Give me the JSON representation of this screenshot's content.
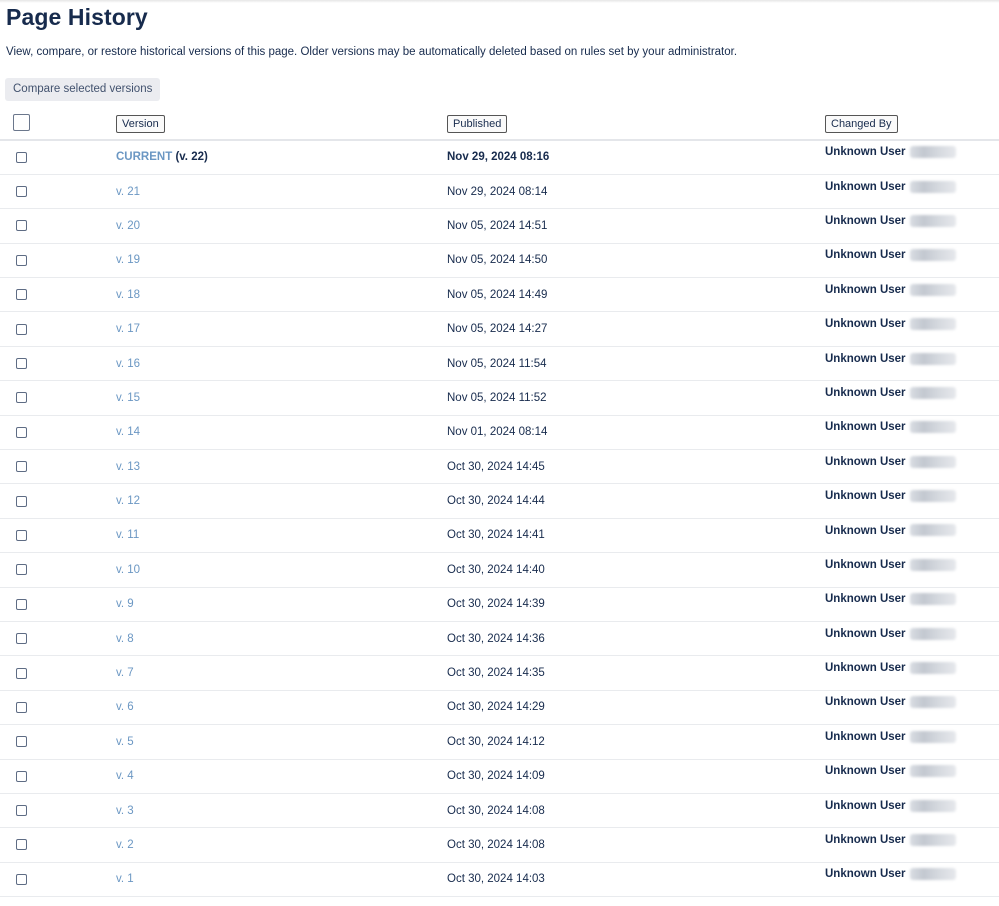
{
  "page": {
    "title": "Page History",
    "intro": "View, compare, or restore historical versions of this page. Older versions may be automatically deleted based on rules set by your administrator.",
    "compare_label": "Compare selected versions"
  },
  "table": {
    "headers": {
      "version": "Version",
      "published": "Published",
      "changed_by": "Changed By"
    },
    "current": {
      "label": "CURRENT",
      "suffix": "(v. 22)",
      "published": "Nov 29, 2024 08:16",
      "changed_by": "Unknown User"
    },
    "rows": [
      {
        "version": "v. 21",
        "published": "Nov 29, 2024 08:14",
        "changed_by": "Unknown User"
      },
      {
        "version": "v. 20",
        "published": "Nov 05, 2024 14:51",
        "changed_by": "Unknown User"
      },
      {
        "version": "v. 19",
        "published": "Nov 05, 2024 14:50",
        "changed_by": "Unknown User"
      },
      {
        "version": "v. 18",
        "published": "Nov 05, 2024 14:49",
        "changed_by": "Unknown User"
      },
      {
        "version": "v. 17",
        "published": "Nov 05, 2024 14:27",
        "changed_by": "Unknown User"
      },
      {
        "version": "v. 16",
        "published": "Nov 05, 2024 11:54",
        "changed_by": "Unknown User"
      },
      {
        "version": "v. 15",
        "published": "Nov 05, 2024 11:52",
        "changed_by": "Unknown User"
      },
      {
        "version": "v. 14",
        "published": "Nov 01, 2024 08:14",
        "changed_by": "Unknown User"
      },
      {
        "version": "v. 13",
        "published": "Oct 30, 2024 14:45",
        "changed_by": "Unknown User"
      },
      {
        "version": "v. 12",
        "published": "Oct 30, 2024 14:44",
        "changed_by": "Unknown User"
      },
      {
        "version": "v. 11",
        "published": "Oct 30, 2024 14:41",
        "changed_by": "Unknown User"
      },
      {
        "version": "v. 10",
        "published": "Oct 30, 2024 14:40",
        "changed_by": "Unknown User"
      },
      {
        "version": "v. 9",
        "published": "Oct 30, 2024 14:39",
        "changed_by": "Unknown User"
      },
      {
        "version": "v. 8",
        "published": "Oct 30, 2024 14:36",
        "changed_by": "Unknown User"
      },
      {
        "version": "v. 7",
        "published": "Oct 30, 2024 14:35",
        "changed_by": "Unknown User"
      },
      {
        "version": "v. 6",
        "published": "Oct 30, 2024 14:29",
        "changed_by": "Unknown User"
      },
      {
        "version": "v. 5",
        "published": "Oct 30, 2024 14:12",
        "changed_by": "Unknown User"
      },
      {
        "version": "v. 4",
        "published": "Oct 30, 2024 14:09",
        "changed_by": "Unknown User"
      },
      {
        "version": "v. 3",
        "published": "Oct 30, 2024 14:08",
        "changed_by": "Unknown User"
      },
      {
        "version": "v. 2",
        "published": "Oct 30, 2024 14:08",
        "changed_by": "Unknown User"
      },
      {
        "version": "v. 1",
        "published": "Oct 30, 2024 14:03",
        "changed_by": "Unknown User"
      }
    ]
  },
  "colors": {
    "link": "#6b97c3",
    "text": "#172b4d",
    "button_bg": "#ebecf0"
  }
}
